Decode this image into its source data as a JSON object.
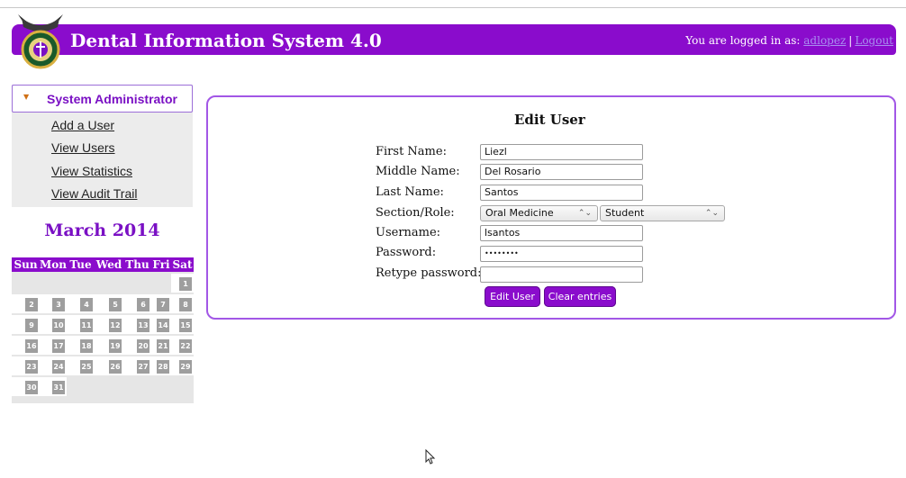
{
  "header": {
    "title": "Dental Information System 4.0",
    "logged_in_text": "You are logged in as:",
    "user": "adlopez",
    "separator": "|",
    "logout": "Logout"
  },
  "sidebar": {
    "section": "System Administrator",
    "items": [
      {
        "label": "Add a User"
      },
      {
        "label": "View Users"
      },
      {
        "label": "View Statistics"
      },
      {
        "label": "View Audit Trail"
      }
    ]
  },
  "calendar": {
    "title": "March 2014",
    "weekdays": [
      "Sun",
      "Mon",
      "Tue",
      "Wed",
      "Thu",
      "Fri",
      "Sat"
    ],
    "days": [
      "1",
      "2",
      "3",
      "4",
      "5",
      "6",
      "7",
      "8",
      "9",
      "10",
      "11",
      "12",
      "13",
      "14",
      "15",
      "16",
      "17",
      "18",
      "19",
      "20",
      "21",
      "22",
      "23",
      "24",
      "25",
      "26",
      "27",
      "28",
      "29",
      "30",
      "31"
    ]
  },
  "form": {
    "title": "Edit User",
    "fields": [
      {
        "label": "First Name:",
        "value": "Liezl"
      },
      {
        "label": "Middle Name:",
        "value": "Del Rosario"
      },
      {
        "label": "Last Name:",
        "value": "Santos"
      },
      {
        "label": "Section/Role:",
        "section": "Oral Medicine",
        "role": "Student"
      },
      {
        "label": "Username:",
        "value": "lsantos"
      },
      {
        "label": "Password:",
        "value": "••••••••"
      },
      {
        "label": "Retype password:",
        "value": ""
      }
    ],
    "submit": "Edit User",
    "clear": "Clear entries"
  },
  "colors": {
    "brand": "#8a0ccc",
    "panel_border": "#a257e6"
  }
}
